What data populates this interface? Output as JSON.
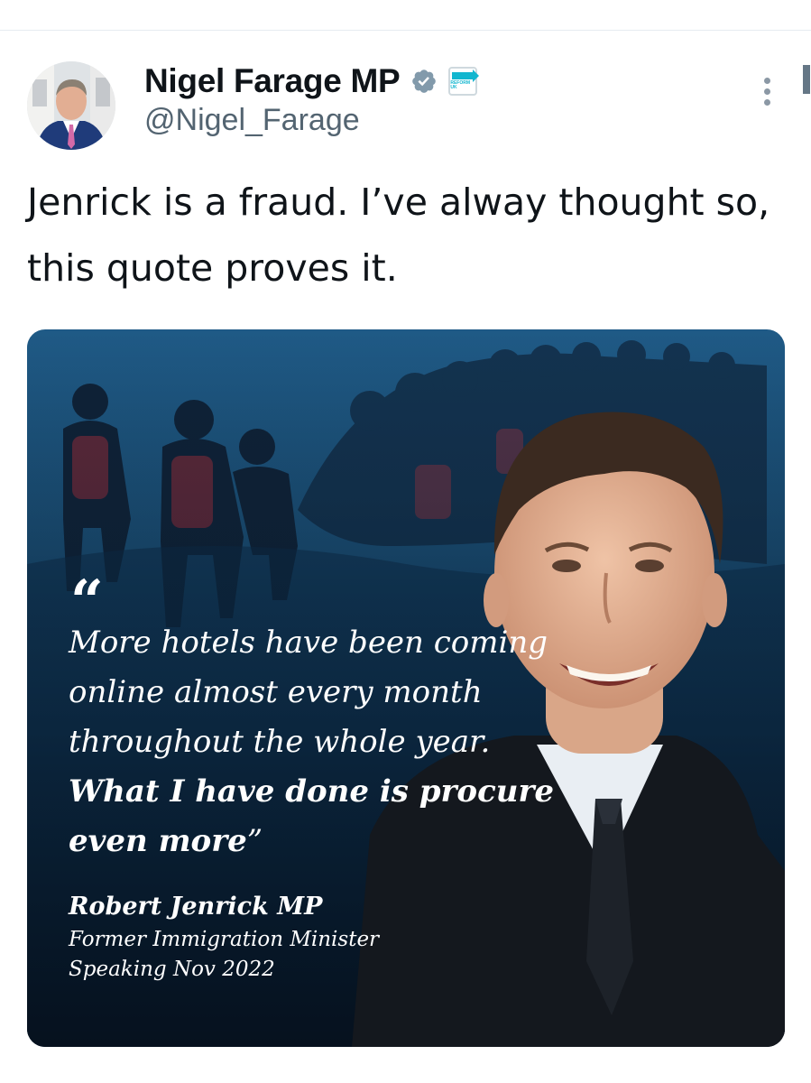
{
  "author": {
    "display_name": "Nigel Farage MP",
    "handle": "@Nigel_Farage",
    "badge_icons": [
      "verified-badge-icon",
      "reform-uk-affiliation-icon"
    ],
    "affiliation_text": "REFORM UK"
  },
  "tweet": {
    "text": "Jenrick is a fraud. I’ve alway thought so, this quote proves it."
  },
  "media": {
    "quote_mark": "“",
    "quote_regular": "More hotels have been coming online almost every month throughout the whole year. ",
    "quote_bold": "What I have done is procure even more",
    "quote_close": "”",
    "speaker": "Robert Jenrick MP",
    "role": "Former Immigration Minister",
    "date": "Speaking Nov 2022"
  },
  "colors": {
    "text": "#0f1419",
    "secondary": "#536471",
    "verified": "#829aab",
    "reform": "#12b6cf",
    "card_bg": "#1a4d73"
  }
}
